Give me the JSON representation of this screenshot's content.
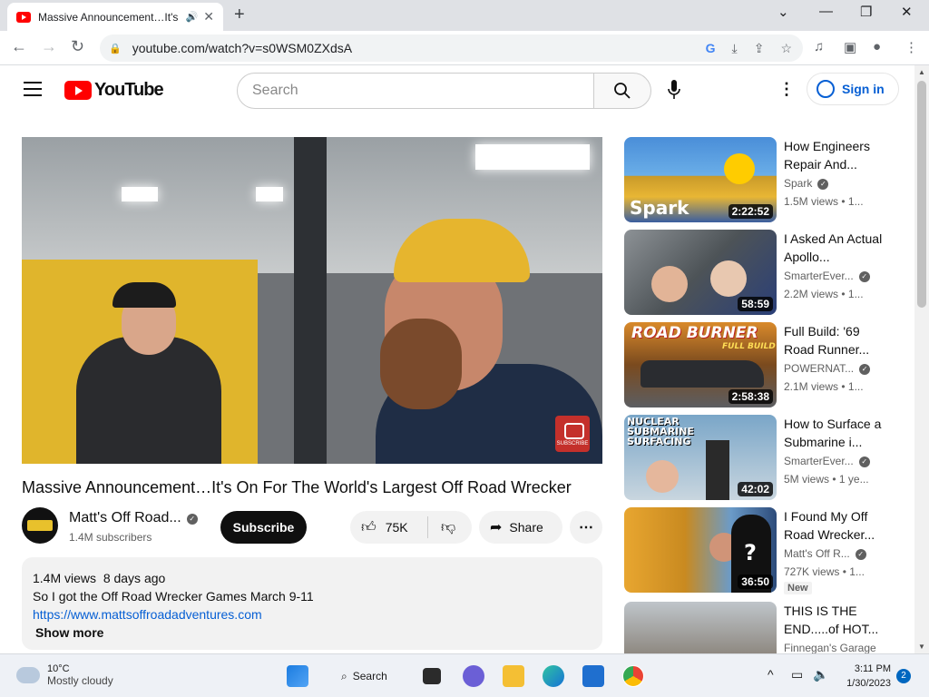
{
  "browser": {
    "tab_title": "Massive Announcement…It's",
    "tab_close": "✕",
    "new_tab": "+",
    "url": "youtube.com/watch?v=s0WSM0ZXdsA"
  },
  "youtube_header": {
    "logo_text": "YouTube",
    "search_placeholder": "Search",
    "signin_label": "Sign in"
  },
  "video": {
    "title": "Massive Announcement…It's On For The World's Largest Off Road Wrecker",
    "watermark_text": "SUBSCRIBE",
    "channel_name": "Matt's Off Road...",
    "subscribers": "1.4M subscribers",
    "subscribe_label": "Subscribe",
    "likes": "75K",
    "share_label": "Share",
    "description": {
      "views": "1.4M views",
      "age": "8 days ago",
      "line1": "So I got the Off Road Wrecker Games March 9-11",
      "link": "https://www.mattsoffroadadventures.com",
      "show_more": "Show more"
    }
  },
  "recommendations": [
    {
      "title": "How Engineers Repair And...",
      "channel": "Spark",
      "verified": true,
      "views": "1.5M views",
      "age": "1...",
      "duration": "2:22:52",
      "thumb_text": "Spark"
    },
    {
      "title": "I Asked An Actual Apollo...",
      "channel": "SmarterEver...",
      "verified": true,
      "views": "2.2M views",
      "age": "1...",
      "duration": "58:59",
      "thumb_text": ""
    },
    {
      "title": "Full Build: '69 Road Runner...",
      "channel": "POWERNAT...",
      "verified": true,
      "views": "2.1M views",
      "age": "1...",
      "duration": "2:58:38",
      "thumb_text": "ROAD BURNER",
      "thumb_sub": "FULL BUILD"
    },
    {
      "title": "How to Surface a Submarine i...",
      "channel": "SmarterEver...",
      "verified": true,
      "views": "5M views",
      "age": "1 ye...",
      "duration": "42:02",
      "thumb_text": "NUCLEAR SUBMARINE SURFACING"
    },
    {
      "title": "I Found My Off Road Wrecker...",
      "channel": "Matt's Off R...",
      "verified": true,
      "views": "727K views",
      "age": "1...",
      "duration": "36:50",
      "badge": "New",
      "thumb_text": "?"
    },
    {
      "title": "THIS IS THE END.....of HOT...",
      "channel": "Finnegan's Garage",
      "verified": false,
      "views": "",
      "age": "",
      "duration": "",
      "thumb_text": ""
    }
  ],
  "taskbar": {
    "temperature": "10°C",
    "weather": "Mostly cloudy",
    "search_label": "Search",
    "time": "3:11 PM",
    "date": "1/30/2023",
    "notifications": "2"
  },
  "colors": {
    "brand_red": "#ff0000",
    "link_blue": "#065fd4",
    "taskbar": "#eef1f6"
  }
}
